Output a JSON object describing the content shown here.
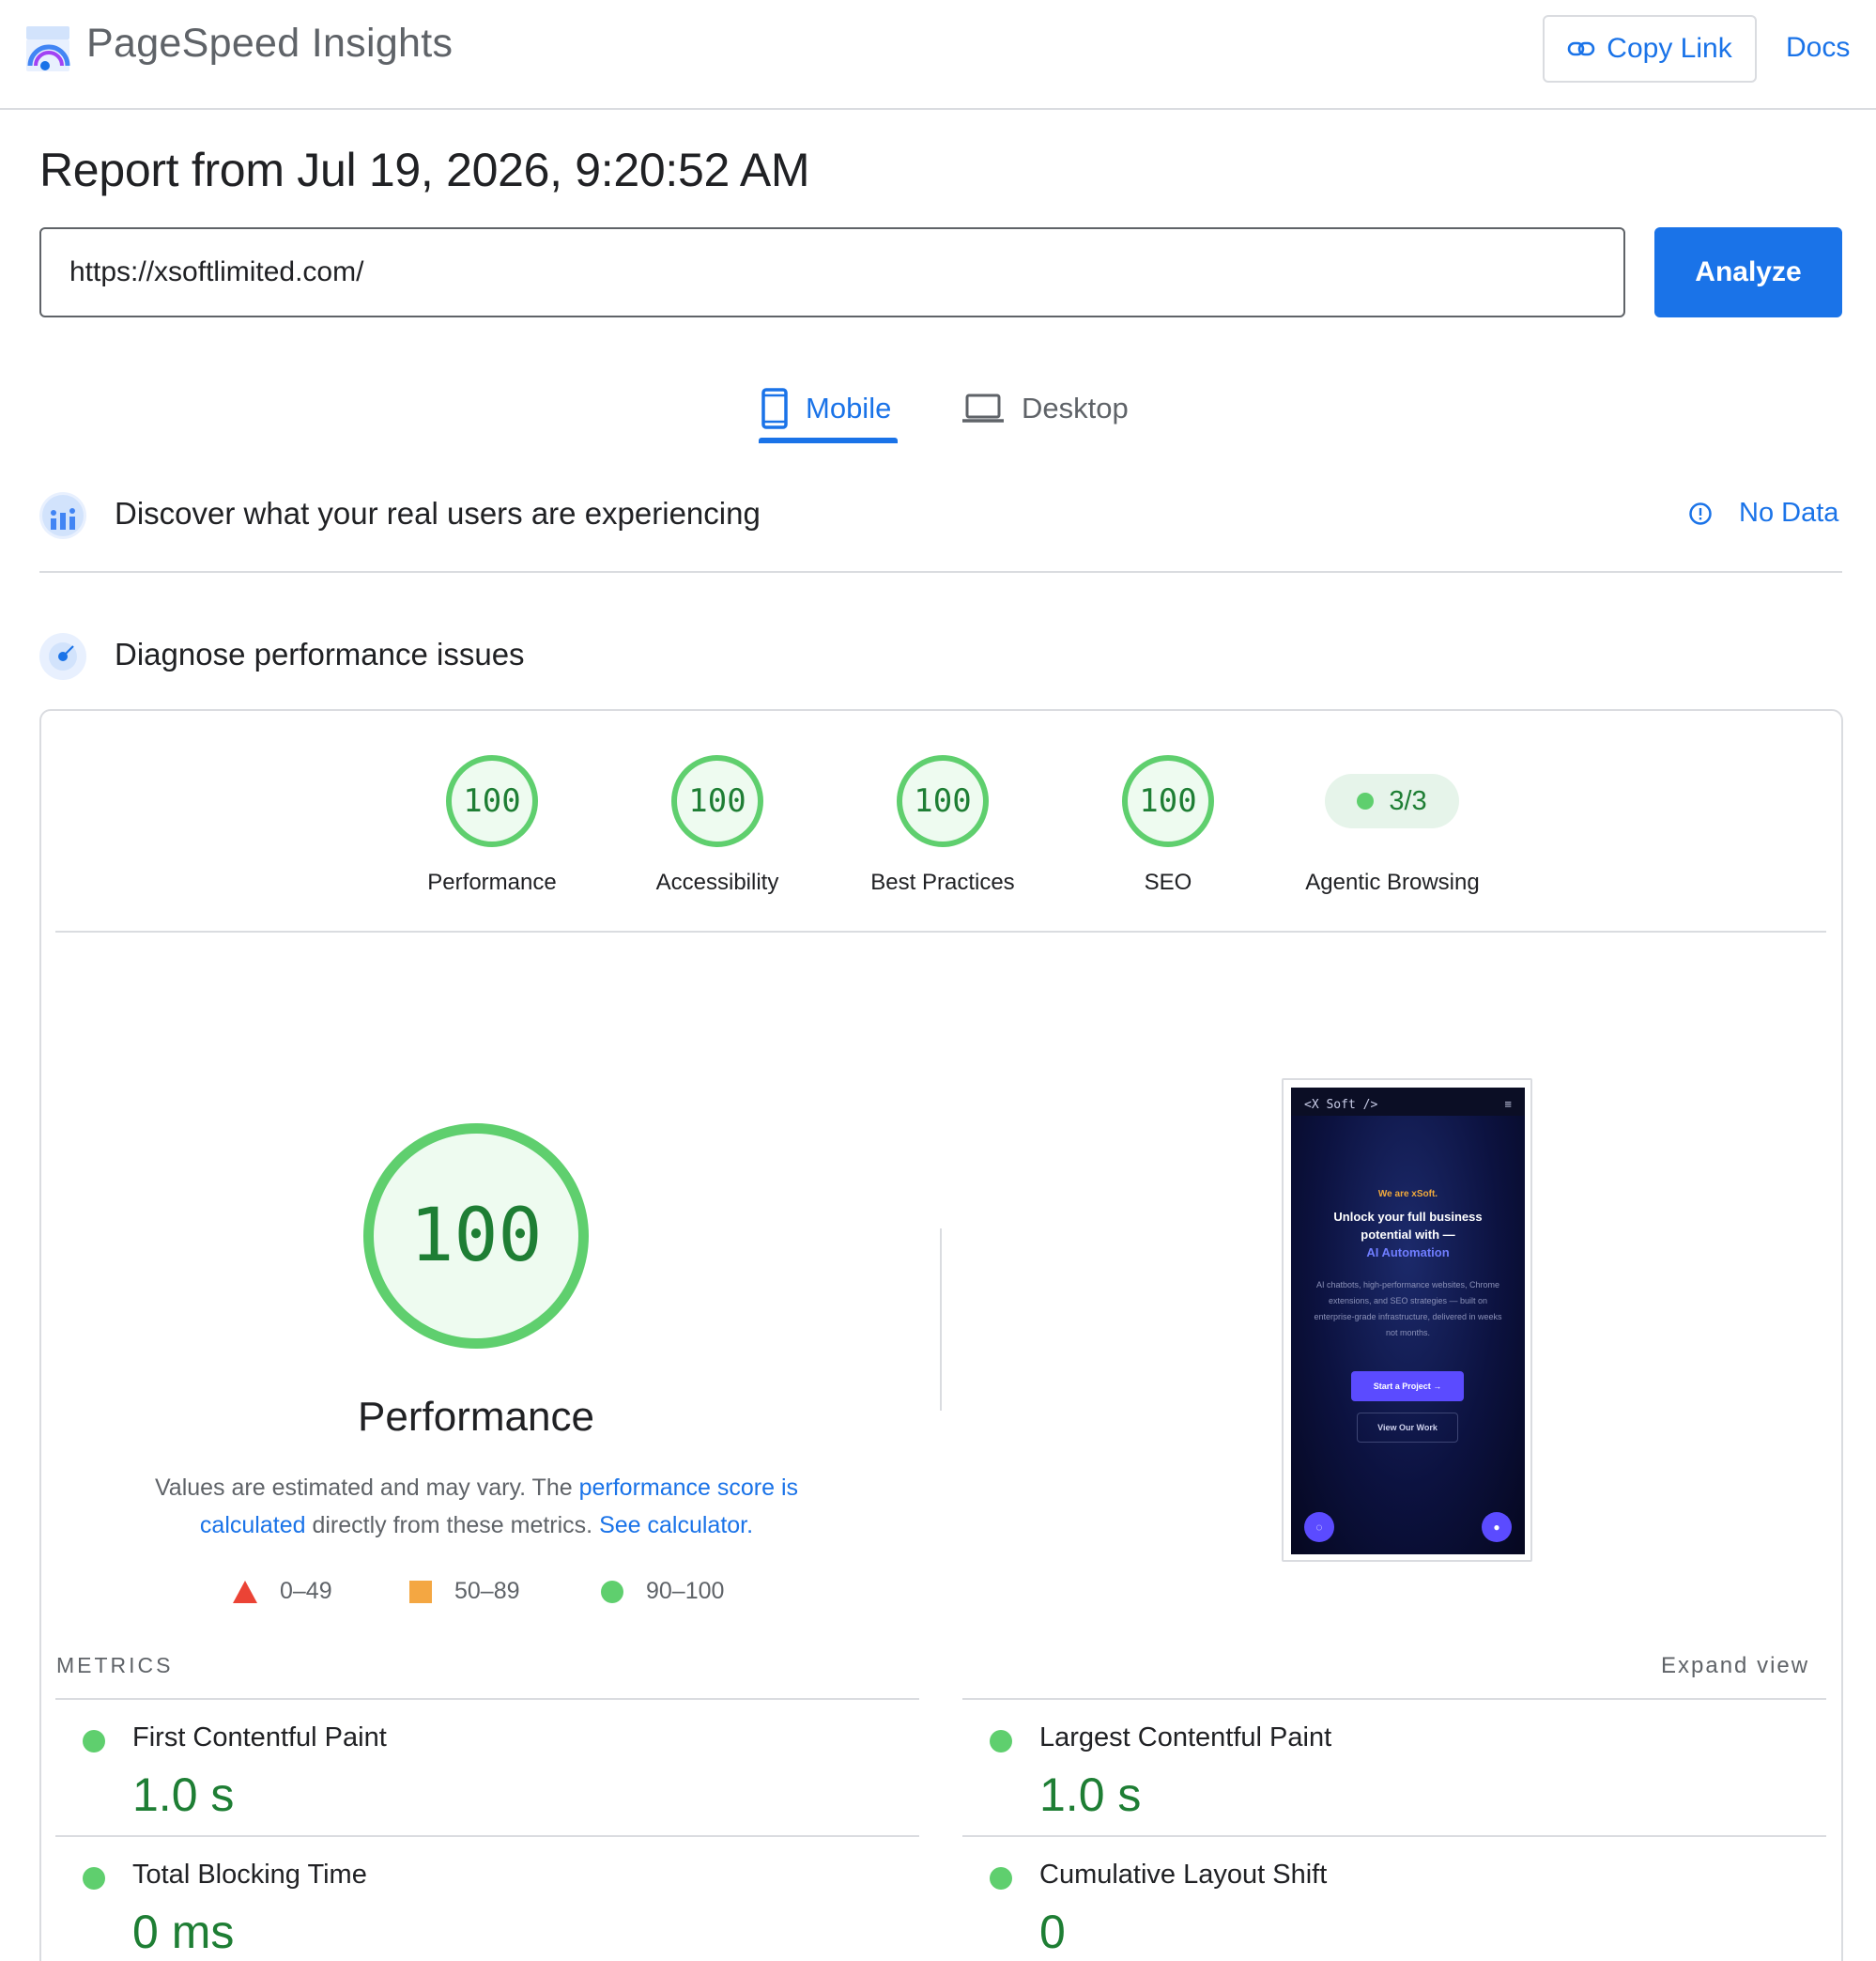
{
  "header": {
    "brand": "PageSpeed Insights",
    "copy_link": "Copy Link",
    "docs": "Docs"
  },
  "report": {
    "title": "Report from Jul 19, 2026, 9:20:52 AM"
  },
  "search": {
    "url_value": "https://xsoftlimited.com/",
    "analyze_label": "Analyze"
  },
  "tabs": [
    {
      "label": "Mobile",
      "icon": "mobile-phone-icon",
      "active": true
    },
    {
      "label": "Desktop",
      "icon": "laptop-icon",
      "active": false
    }
  ],
  "field_data": {
    "title": "Discover what your real users are experiencing",
    "status": "No Data"
  },
  "lab_data": {
    "title": "Diagnose performance issues"
  },
  "scores": [
    {
      "label": "Performance",
      "value": "100"
    },
    {
      "label": "Accessibility",
      "value": "100"
    },
    {
      "label": "Best Practices",
      "value": "100"
    },
    {
      "label": "SEO",
      "value": "100"
    },
    {
      "label": "Agentic Browsing",
      "value": "3/3"
    }
  ],
  "performance": {
    "score": "100",
    "title": "Performance",
    "desc_prefix": "Values are estimated and may vary. The ",
    "desc_link1": "performance score is calculated",
    "desc_mid": " directly from these metrics. ",
    "desc_link2": "See calculator."
  },
  "legend": [
    {
      "shape": "triangle",
      "range": "0–49",
      "color": "#eb4335"
    },
    {
      "shape": "square",
      "range": "50–89",
      "color": "#f4a742"
    },
    {
      "shape": "circle",
      "range": "90–100",
      "color": "#5fcf6e"
    }
  ],
  "screenshot": {
    "logo": "<X Soft />",
    "eyebrow": "We are xSoft.",
    "headline": "Unlock your full business potential with —",
    "headline_accent": "AI Automation",
    "body": "AI chatbots, high-performance websites, Chrome extensions, and SEO strategies — built on enterprise-grade infrastructure, delivered in weeks not months.",
    "cta_primary": "Start a Project →",
    "cta_secondary": "View Our Work"
  },
  "metrics": {
    "label": "METRICS",
    "expand": "Expand view",
    "items": [
      {
        "name": "First Contentful Paint",
        "value": "1.0 s"
      },
      {
        "name": "Largest Contentful Paint",
        "value": "1.0 s"
      },
      {
        "name": "Total Blocking Time",
        "value": "0 ms"
      },
      {
        "name": "Cumulative Layout Shift",
        "value": "0"
      }
    ]
  },
  "colors": {
    "accent": "#1a73e8",
    "pass": "#5fcf6e",
    "pass_text": "#1e7e34",
    "divider": "#dadce0"
  }
}
